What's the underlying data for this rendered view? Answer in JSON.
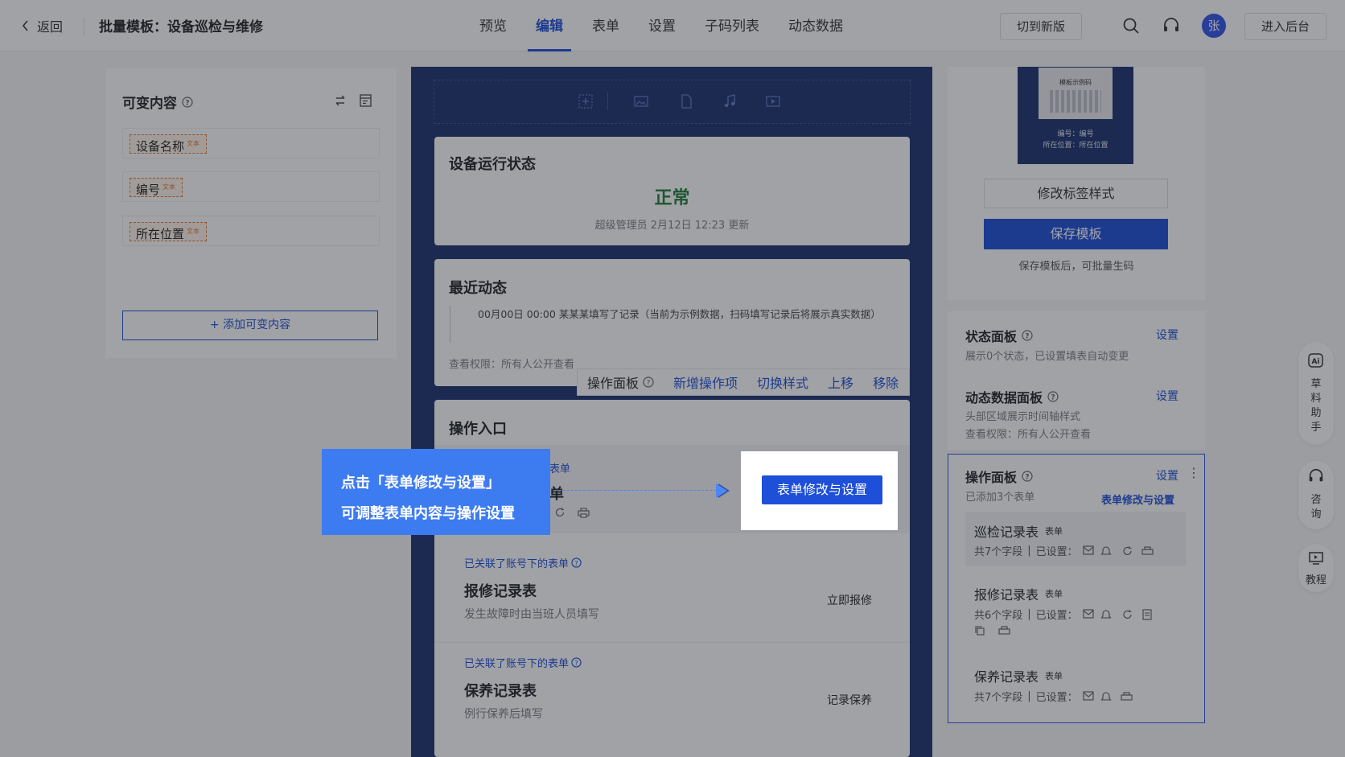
{
  "topbar": {
    "back_label": "返回",
    "title": "批量模板：设备巡检与维修",
    "tabs": [
      "预览",
      "编辑",
      "表单",
      "设置",
      "子码列表",
      "动态数据"
    ],
    "active_tab": "编辑",
    "switch_label": "切到新版",
    "avatar_text": "张",
    "admin_label": "进入后台"
  },
  "left": {
    "title": "可变内容",
    "variables": [
      {
        "label": "设备名称",
        "tag": "文本"
      },
      {
        "label": "编号",
        "tag": "文本"
      },
      {
        "label": "所在位置",
        "tag": "文本"
      }
    ],
    "add_label": "+ 添加可变内容"
  },
  "center": {
    "status": {
      "title": "设备运行状态",
      "value": "正常",
      "meta": "超级管理员 2月12日 12:23 更新"
    },
    "recent": {
      "title": "最近动态",
      "entry": "00月00日 00:00   某某某填写了记录（当前为示例数据，扫码填写记录后将展示真实数据）",
      "permission": "查看权限：所有人公开查看"
    },
    "op_toolbar": [
      "操作面板",
      "新增操作项",
      "切换样式",
      "上移",
      "移除"
    ],
    "entry": {
      "title": "操作入口",
      "first_link_fragment": "表单",
      "first_name_fragment": "单",
      "forms": [
        {
          "link": "已关联了账号下的表单",
          "name": "报修记录表",
          "desc": "发生故障时由当班人员填写",
          "action": "立即报修"
        },
        {
          "link": "已关联了账号下的表单",
          "name": "保养记录表",
          "desc": "例行保养后填写",
          "action": "记录保养"
        }
      ]
    }
  },
  "right": {
    "qr": {
      "label": "模板示例码",
      "line1": "编号：编号",
      "line2": "所在位置：所在位置"
    },
    "edit_label_btn": "修改标签样式",
    "save_btn": "保存模板",
    "save_hint": "保存模板后，可批量生码",
    "status_panel": {
      "title": "状态面板",
      "link": "设置",
      "desc": "展示0个状态，已设置填表自动变更"
    },
    "dynamic_panel": {
      "title": "动态数据面板",
      "link": "设置",
      "desc1": "头部区域展示时间轴样式",
      "desc2": "查看权限：所有人公开查看"
    },
    "op_panel": {
      "title": "操作面板",
      "link": "设置",
      "count": "已添加3个表单",
      "highlight_link": "表单修改与设置",
      "forms": [
        {
          "name": "巡检记录表",
          "badge": "表单",
          "fields": "共7个字段",
          "set": "已设置："
        },
        {
          "name": "报修记录表",
          "badge": "表单",
          "fields": "共6个字段",
          "set": "已设置："
        },
        {
          "name": "保养记录表",
          "badge": "表单",
          "fields": "共7个字段",
          "set": "已设置："
        }
      ]
    }
  },
  "sidebar": [
    {
      "icon": "ai-icon",
      "label": "草料助手"
    },
    {
      "icon": "headset-icon",
      "label": "咨询"
    },
    {
      "icon": "monitor-icon",
      "label": "教程"
    }
  ],
  "overlay": {
    "tip_line1": "点击「表单修改与设置」",
    "tip_line2": "可调整表单内容与操作设置",
    "button": "表单修改与设置"
  },
  "colors": {
    "primary": "#1d4fd8",
    "navy": "#1b3170",
    "success": "#1a7f37",
    "tip": "#3d7bf0",
    "variable_tag": "#e0772d"
  }
}
